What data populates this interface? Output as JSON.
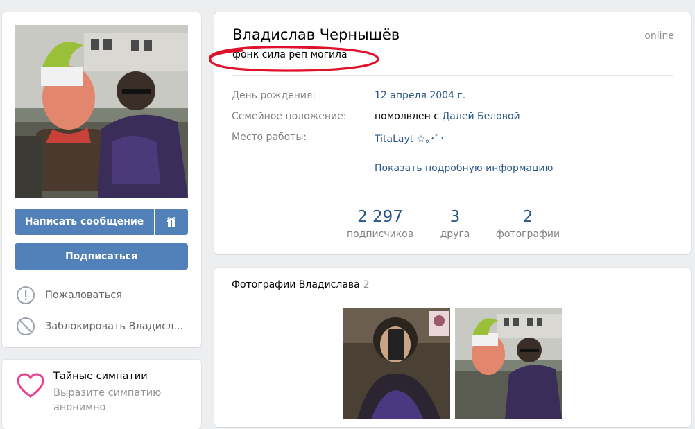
{
  "profile": {
    "name": "Владислав Чернышёв",
    "online": "online",
    "status": "фонк сила реп могила",
    "info": [
      {
        "label": "День рождения:",
        "value": "12 апреля 2004 г."
      },
      {
        "label": "Семейное положение:",
        "value_prefix": "помолвлен с ",
        "value_link": "Далей Беловой"
      },
      {
        "label": "Место работы:",
        "value": "TitaLayt ☆｡･ﾟ･"
      }
    ],
    "more_info": "Показать подробную информацию",
    "counters": [
      {
        "value": "2 297",
        "label": "подписчиков"
      },
      {
        "value": "3",
        "label": "друга"
      },
      {
        "value": "2",
        "label": "фотографии"
      }
    ]
  },
  "actions": {
    "message": "Написать сообщение",
    "gift_icon": "gift-icon",
    "subscribe": "Подписаться",
    "report": "Пожаловаться",
    "block": "Заблокировать Владисл..."
  },
  "sympathy": {
    "title": "Тайные симпатии",
    "description": "Выразите симпатию анонимно"
  },
  "photos": {
    "title": "Фотографии Владислава",
    "count": "2"
  },
  "colors": {
    "accent": "#5181b8",
    "link": "#2a5885",
    "annotation": "#e0112b",
    "heart": "#e64690"
  }
}
